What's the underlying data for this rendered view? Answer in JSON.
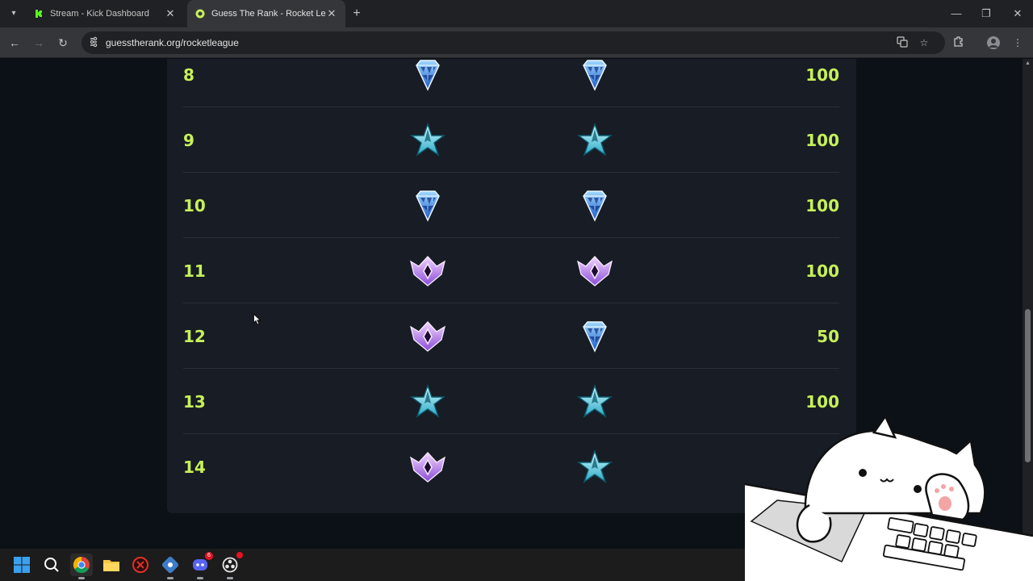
{
  "browser": {
    "tabs": [
      {
        "title": "Stream - Kick Dashboard",
        "active": false
      },
      {
        "title": "Guess The Rank - Rocket League",
        "active": true
      }
    ],
    "url": "guesstherank.org/rocketleague",
    "icons": [
      "tab-search-icon",
      "back-icon",
      "forward-icon",
      "reload-icon",
      "site-info-icon",
      "translate-icon",
      "bookmark-star-icon",
      "extensions-icon",
      "profile-icon",
      "more-icon"
    ]
  },
  "results": {
    "rows": [
      {
        "round": "8",
        "guess": "diamond",
        "actual": "diamond",
        "score": "100"
      },
      {
        "round": "9",
        "guess": "champion",
        "actual": "champion",
        "score": "100"
      },
      {
        "round": "10",
        "guess": "diamond",
        "actual": "diamond",
        "score": "100"
      },
      {
        "round": "11",
        "guess": "grand-champion",
        "actual": "grand-champion",
        "score": "100"
      },
      {
        "round": "12",
        "guess": "grand-champion",
        "actual": "diamond",
        "score": "50"
      },
      {
        "round": "13",
        "guess": "champion",
        "actual": "champion",
        "score": "100"
      },
      {
        "round": "14",
        "guess": "grand-champion",
        "actual": "champion",
        "score": ""
      }
    ]
  },
  "taskbar": {
    "icons": [
      "windows-start-icon",
      "search-icon",
      "chrome-icon",
      "file-explorer-icon",
      "app-red-icon",
      "app-network-icon",
      "discord-icon",
      "app-obs-icon"
    ],
    "discord_badge": "6"
  },
  "colors": {
    "accent": "#c6f05a",
    "card": "#181c24",
    "background": "#0c1017"
  }
}
